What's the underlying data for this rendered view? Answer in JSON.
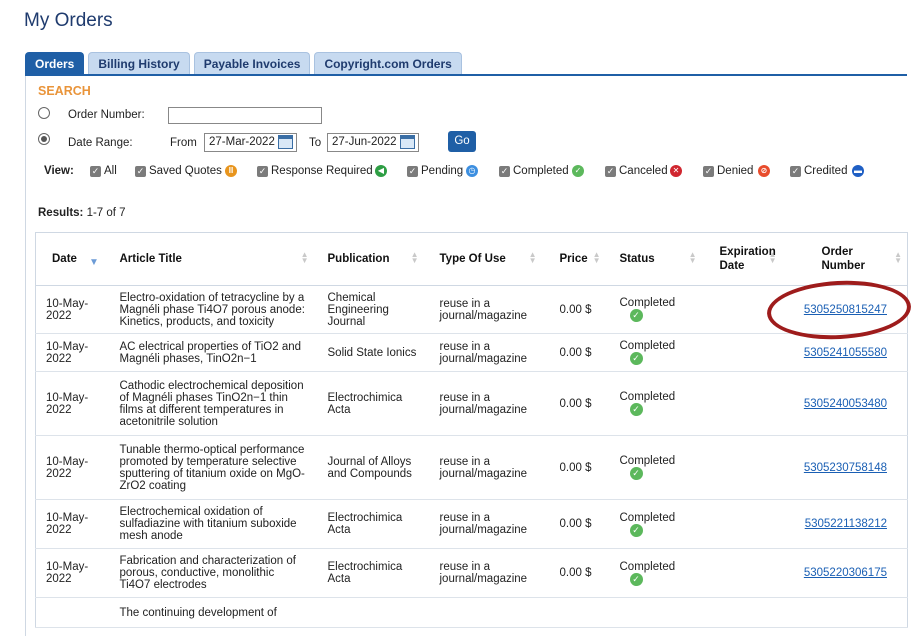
{
  "page_title": "My Orders",
  "tabs": [
    {
      "label": "Orders",
      "active": true
    },
    {
      "label": "Billing History",
      "active": false
    },
    {
      "label": "Payable Invoices",
      "active": false
    },
    {
      "label": "Copyright.com Orders",
      "active": false
    }
  ],
  "search": {
    "title": "SEARCH",
    "order_number_label": "Order Number:",
    "order_number_value": "",
    "date_range_label": "Date Range:",
    "from_label": "From",
    "from_value": "27-Mar-2022",
    "to_label": "To",
    "to_value": "27-Jun-2022",
    "go_label": "Go",
    "selected_option": "Date Range"
  },
  "view": {
    "label": "View:",
    "filters": [
      {
        "label": "All",
        "checked": true,
        "icon": null
      },
      {
        "label": "Saved Quotes",
        "checked": true,
        "icon": "pause-icon",
        "color": "#e8951e"
      },
      {
        "label": "Response Required",
        "checked": true,
        "icon": "reply-icon",
        "color": "#2e9e44"
      },
      {
        "label": "Pending",
        "checked": true,
        "icon": "clock-icon",
        "color": "#3d8fe0"
      },
      {
        "label": "Completed",
        "checked": true,
        "icon": "check-icon",
        "color": "#5cb85c"
      },
      {
        "label": "Canceled",
        "checked": true,
        "icon": "x-icon",
        "color": "#d0262f"
      },
      {
        "label": "Denied",
        "checked": true,
        "icon": "no-icon",
        "color": "#e84c2c"
      },
      {
        "label": "Credited",
        "checked": true,
        "icon": "credit-icon",
        "color": "#1f5fc4"
      }
    ]
  },
  "results": {
    "label": "Results:",
    "value": "1-7 of 7"
  },
  "table": {
    "columns": [
      "Date",
      "Article Title",
      "Publication",
      "Type Of Use",
      "Price",
      "Status",
      "Expiration Date",
      "Order Number"
    ],
    "rows": [
      {
        "date": "10-May-2022",
        "title": "Electro-oxidation of tetracycline by a Magnéli phase Ti4O7 porous anode: Kinetics, products, and toxicity",
        "publication": "Chemical Engineering Journal",
        "use": "reuse in a journal/magazine",
        "price": "0.00 $",
        "status": "Completed",
        "expiration": "",
        "order": "5305250815247"
      },
      {
        "date": "10-May-2022",
        "title": "AC electrical properties of TiO2 and Magnéli phases, TinO2n−1",
        "publication": "Solid State Ionics",
        "use": "reuse in a journal/magazine",
        "price": "0.00 $",
        "status": "Completed",
        "expiration": "",
        "order": "5305241055580"
      },
      {
        "date": "10-May-2022",
        "title": "Cathodic electrochemical deposition of Magnéli phases TinO2n−1 thin films at different temperatures in acetonitrile solution",
        "publication": "Electrochimica Acta",
        "use": "reuse in a journal/magazine",
        "price": "0.00 $",
        "status": "Completed",
        "expiration": "",
        "order": "5305240053480"
      },
      {
        "date": "10-May-2022",
        "title": "Tunable thermo-optical performance promoted by temperature selective sputtering of titanium oxide on MgO-ZrO2 coating",
        "publication": "Journal of Alloys and Compounds",
        "use": "reuse in a journal/magazine",
        "price": "0.00 $",
        "status": "Completed",
        "expiration": "",
        "order": "5305230758148"
      },
      {
        "date": "10-May-2022",
        "title": "Electrochemical oxidation of sulfadiazine with titanium suboxide mesh anode",
        "publication": "Electrochimica Acta",
        "use": "reuse in a journal/magazine",
        "price": "0.00 $",
        "status": "Completed",
        "expiration": "",
        "order": "5305221138212"
      },
      {
        "date": "10-May-2022",
        "title": "Fabrication and characterization of porous, conductive, monolithic Ti4O7 electrodes",
        "publication": "Electrochimica Acta",
        "use": "reuse in a journal/magazine",
        "price": "0.00 $",
        "status": "Completed",
        "expiration": "",
        "order": "5305220306175"
      },
      {
        "date": "",
        "title": "The continuing development of",
        "publication": "",
        "use": "",
        "price": "",
        "status": "",
        "expiration": "",
        "order": ""
      }
    ]
  }
}
